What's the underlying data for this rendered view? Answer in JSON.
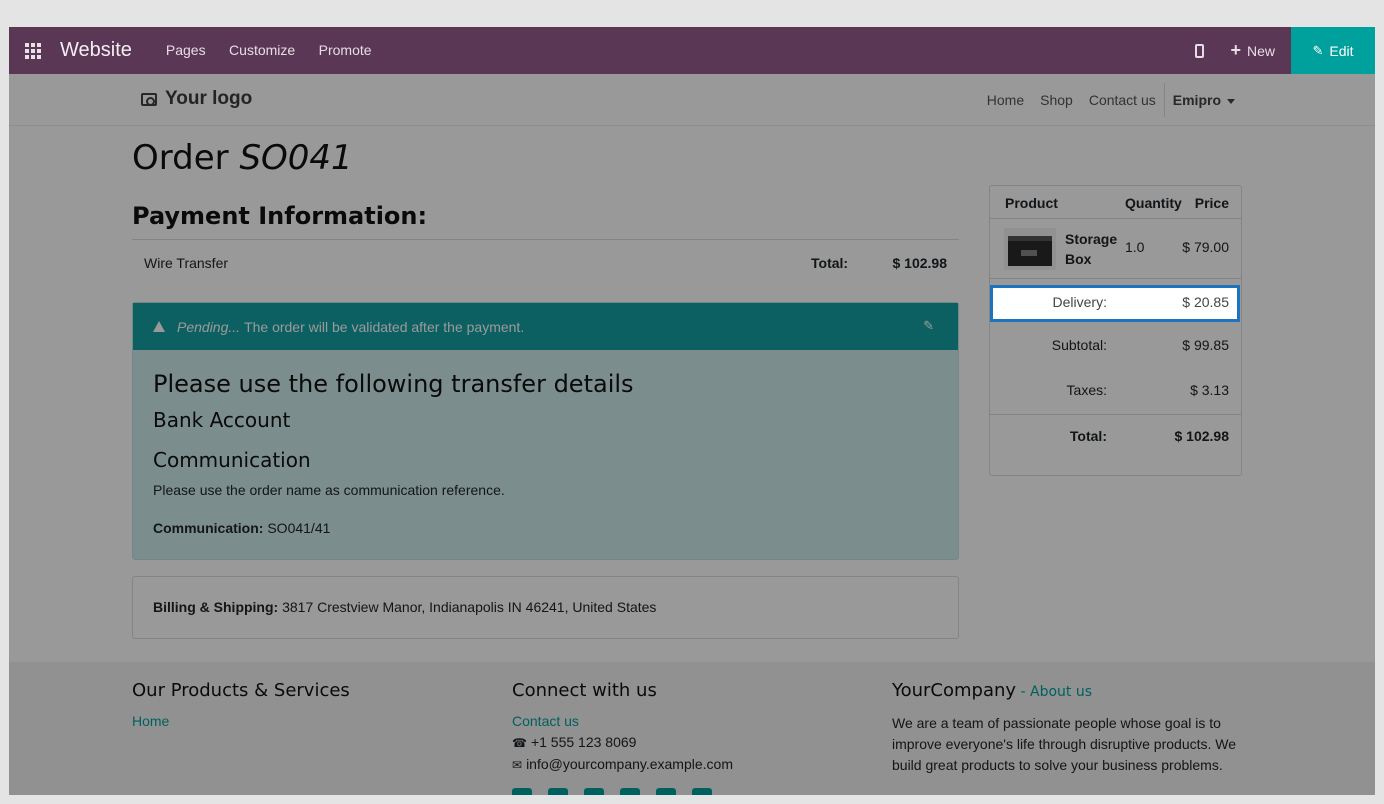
{
  "topbar": {
    "brand": "Website",
    "menu": [
      "Pages",
      "Customize",
      "Promote"
    ],
    "new_label": "New",
    "edit_label": "Edit"
  },
  "site": {
    "logo_text": "Your logo",
    "nav": [
      "Home",
      "Shop",
      "Contact us"
    ],
    "user": "Emipro"
  },
  "order": {
    "title_prefix": "Order",
    "name": "SO041"
  },
  "payment": {
    "heading": "Payment Information:",
    "method": "Wire Transfer",
    "total_label": "Total:",
    "total_value": "$ 102.98"
  },
  "alert": {
    "status": "Pending...",
    "message": "The order will be validated after the payment.",
    "heading": "Please use the following transfer details",
    "bank_heading": "Bank Account",
    "comm_heading": "Communication",
    "comm_text": "Please use the order name as communication reference.",
    "comm_label": "Communication:",
    "comm_value": "SO041/41"
  },
  "billing": {
    "label": "Billing & Shipping:",
    "address": "3817 Crestview Manor, Indianapolis IN 46241, United States"
  },
  "summary": {
    "col_product": "Product",
    "col_quantity": "Quantity",
    "col_price": "Price",
    "product_name": "Storage Box",
    "product_qty": "1.0",
    "product_price": "$ 79.00",
    "delivery_label": "Delivery:",
    "delivery_value": "$ 20.85",
    "subtotal_label": "Subtotal:",
    "subtotal_value": "$ 99.85",
    "taxes_label": "Taxes:",
    "taxes_value": "$ 3.13",
    "total_label": "Total:",
    "total_value": "$ 102.98"
  },
  "footer": {
    "col1_title": "Our Products & Services",
    "col1_link": "Home",
    "col2_title": "Connect with us",
    "col2_link": "Contact us",
    "phone": "+1 555 123 8069",
    "email": "info@yourcompany.example.com",
    "col3_title": "YourCompany",
    "col3_sep": " - ",
    "col3_link": "About us",
    "col3_text": "We are a team of passionate people whose goal is to improve everyone's life through disruptive products. We build great products to solve your business problems."
  },
  "colors": {
    "topbar": "#5a3754",
    "accent": "#00a09d",
    "highlight_border": "#1e73be"
  }
}
